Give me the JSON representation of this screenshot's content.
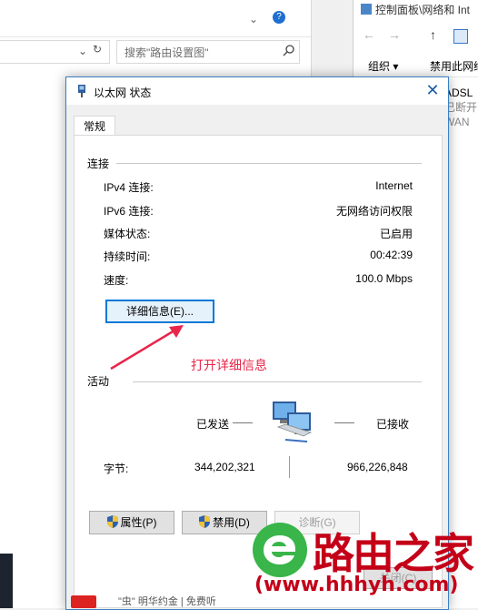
{
  "background": {
    "left_search_placeholder": "搜索\"路由设置图\"",
    "right_window_title": "控制面板\\网络和 Int",
    "right_command_organize": "组织 ▾",
    "right_command_disable": "禁用此网络",
    "right_list_lines": [
      "ADSL",
      "已断开",
      "WAN"
    ],
    "bottom_text": "\"虫\" 明华约金 | 免费听"
  },
  "dialog": {
    "title": "以太网 状态",
    "close_glyph": "✕",
    "tab_label": "常规",
    "connection_group": "连接",
    "rows": [
      {
        "label": "IPv4 连接:",
        "value": "Internet"
      },
      {
        "label": "IPv6 连接:",
        "value": "无网络访问权限"
      },
      {
        "label": "媒体状态:",
        "value": "已启用"
      },
      {
        "label": "持续时间:",
        "value": "00:42:39"
      },
      {
        "label": "速度:",
        "value": "100.0 Mbps"
      }
    ],
    "details_button": "详细信息(E)...",
    "annotation": "打开详细信息",
    "activity_group": "活动",
    "sent_label": "已发送",
    "received_label": "已接收",
    "bytes_label": "字节:",
    "bytes_sent": "344,202,321",
    "bytes_received": "966,226,848",
    "properties_button": "属性(P)",
    "disable_button": "禁用(D)",
    "diagnose_button": "诊断(G)",
    "close_button": "关闭(C)"
  },
  "watermark": {
    "brand": "路由之家",
    "url": "(www.hhhyh.com)"
  },
  "colors": {
    "accent": "#0078d7",
    "annotation": "#e8264a",
    "watermark_red": "#c40018",
    "watermark_green": "#39b54a"
  }
}
